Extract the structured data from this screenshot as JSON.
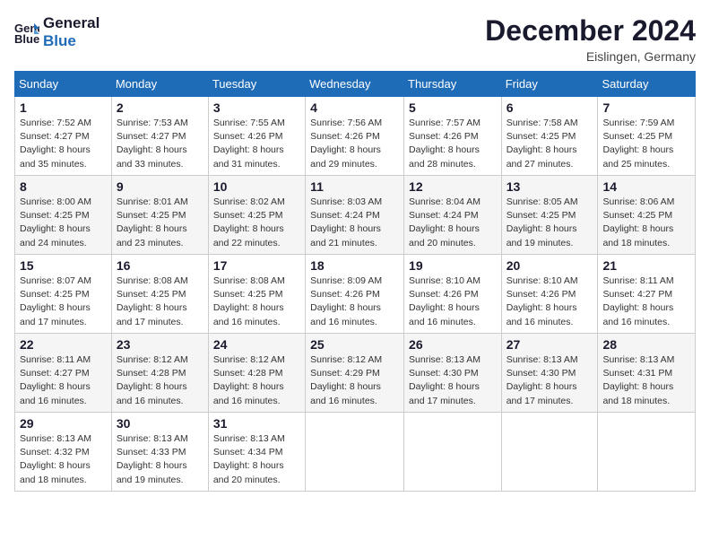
{
  "logo": {
    "line1": "General",
    "line2": "Blue"
  },
  "title": "December 2024",
  "location": "Eislingen, Germany",
  "days_header": [
    "Sunday",
    "Monday",
    "Tuesday",
    "Wednesday",
    "Thursday",
    "Friday",
    "Saturday"
  ],
  "weeks": [
    [
      {
        "day": "1",
        "sunrise": "7:52 AM",
        "sunset": "4:27 PM",
        "daylight": "8 hours and 35 minutes."
      },
      {
        "day": "2",
        "sunrise": "7:53 AM",
        "sunset": "4:27 PM",
        "daylight": "8 hours and 33 minutes."
      },
      {
        "day": "3",
        "sunrise": "7:55 AM",
        "sunset": "4:26 PM",
        "daylight": "8 hours and 31 minutes."
      },
      {
        "day": "4",
        "sunrise": "7:56 AM",
        "sunset": "4:26 PM",
        "daylight": "8 hours and 29 minutes."
      },
      {
        "day": "5",
        "sunrise": "7:57 AM",
        "sunset": "4:26 PM",
        "daylight": "8 hours and 28 minutes."
      },
      {
        "day": "6",
        "sunrise": "7:58 AM",
        "sunset": "4:25 PM",
        "daylight": "8 hours and 27 minutes."
      },
      {
        "day": "7",
        "sunrise": "7:59 AM",
        "sunset": "4:25 PM",
        "daylight": "8 hours and 25 minutes."
      }
    ],
    [
      {
        "day": "8",
        "sunrise": "8:00 AM",
        "sunset": "4:25 PM",
        "daylight": "8 hours and 24 minutes."
      },
      {
        "day": "9",
        "sunrise": "8:01 AM",
        "sunset": "4:25 PM",
        "daylight": "8 hours and 23 minutes."
      },
      {
        "day": "10",
        "sunrise": "8:02 AM",
        "sunset": "4:25 PM",
        "daylight": "8 hours and 22 minutes."
      },
      {
        "day": "11",
        "sunrise": "8:03 AM",
        "sunset": "4:24 PM",
        "daylight": "8 hours and 21 minutes."
      },
      {
        "day": "12",
        "sunrise": "8:04 AM",
        "sunset": "4:24 PM",
        "daylight": "8 hours and 20 minutes."
      },
      {
        "day": "13",
        "sunrise": "8:05 AM",
        "sunset": "4:25 PM",
        "daylight": "8 hours and 19 minutes."
      },
      {
        "day": "14",
        "sunrise": "8:06 AM",
        "sunset": "4:25 PM",
        "daylight": "8 hours and 18 minutes."
      }
    ],
    [
      {
        "day": "15",
        "sunrise": "8:07 AM",
        "sunset": "4:25 PM",
        "daylight": "8 hours and 17 minutes."
      },
      {
        "day": "16",
        "sunrise": "8:08 AM",
        "sunset": "4:25 PM",
        "daylight": "8 hours and 17 minutes."
      },
      {
        "day": "17",
        "sunrise": "8:08 AM",
        "sunset": "4:25 PM",
        "daylight": "8 hours and 16 minutes."
      },
      {
        "day": "18",
        "sunrise": "8:09 AM",
        "sunset": "4:26 PM",
        "daylight": "8 hours and 16 minutes."
      },
      {
        "day": "19",
        "sunrise": "8:10 AM",
        "sunset": "4:26 PM",
        "daylight": "8 hours and 16 minutes."
      },
      {
        "day": "20",
        "sunrise": "8:10 AM",
        "sunset": "4:26 PM",
        "daylight": "8 hours and 16 minutes."
      },
      {
        "day": "21",
        "sunrise": "8:11 AM",
        "sunset": "4:27 PM",
        "daylight": "8 hours and 16 minutes."
      }
    ],
    [
      {
        "day": "22",
        "sunrise": "8:11 AM",
        "sunset": "4:27 PM",
        "daylight": "8 hours and 16 minutes."
      },
      {
        "day": "23",
        "sunrise": "8:12 AM",
        "sunset": "4:28 PM",
        "daylight": "8 hours and 16 minutes."
      },
      {
        "day": "24",
        "sunrise": "8:12 AM",
        "sunset": "4:28 PM",
        "daylight": "8 hours and 16 minutes."
      },
      {
        "day": "25",
        "sunrise": "8:12 AM",
        "sunset": "4:29 PM",
        "daylight": "8 hours and 16 minutes."
      },
      {
        "day": "26",
        "sunrise": "8:13 AM",
        "sunset": "4:30 PM",
        "daylight": "8 hours and 17 minutes."
      },
      {
        "day": "27",
        "sunrise": "8:13 AM",
        "sunset": "4:30 PM",
        "daylight": "8 hours and 17 minutes."
      },
      {
        "day": "28",
        "sunrise": "8:13 AM",
        "sunset": "4:31 PM",
        "daylight": "8 hours and 18 minutes."
      }
    ],
    [
      {
        "day": "29",
        "sunrise": "8:13 AM",
        "sunset": "4:32 PM",
        "daylight": "8 hours and 18 minutes."
      },
      {
        "day": "30",
        "sunrise": "8:13 AM",
        "sunset": "4:33 PM",
        "daylight": "8 hours and 19 minutes."
      },
      {
        "day": "31",
        "sunrise": "8:13 AM",
        "sunset": "4:34 PM",
        "daylight": "8 hours and 20 minutes."
      },
      null,
      null,
      null,
      null
    ]
  ]
}
